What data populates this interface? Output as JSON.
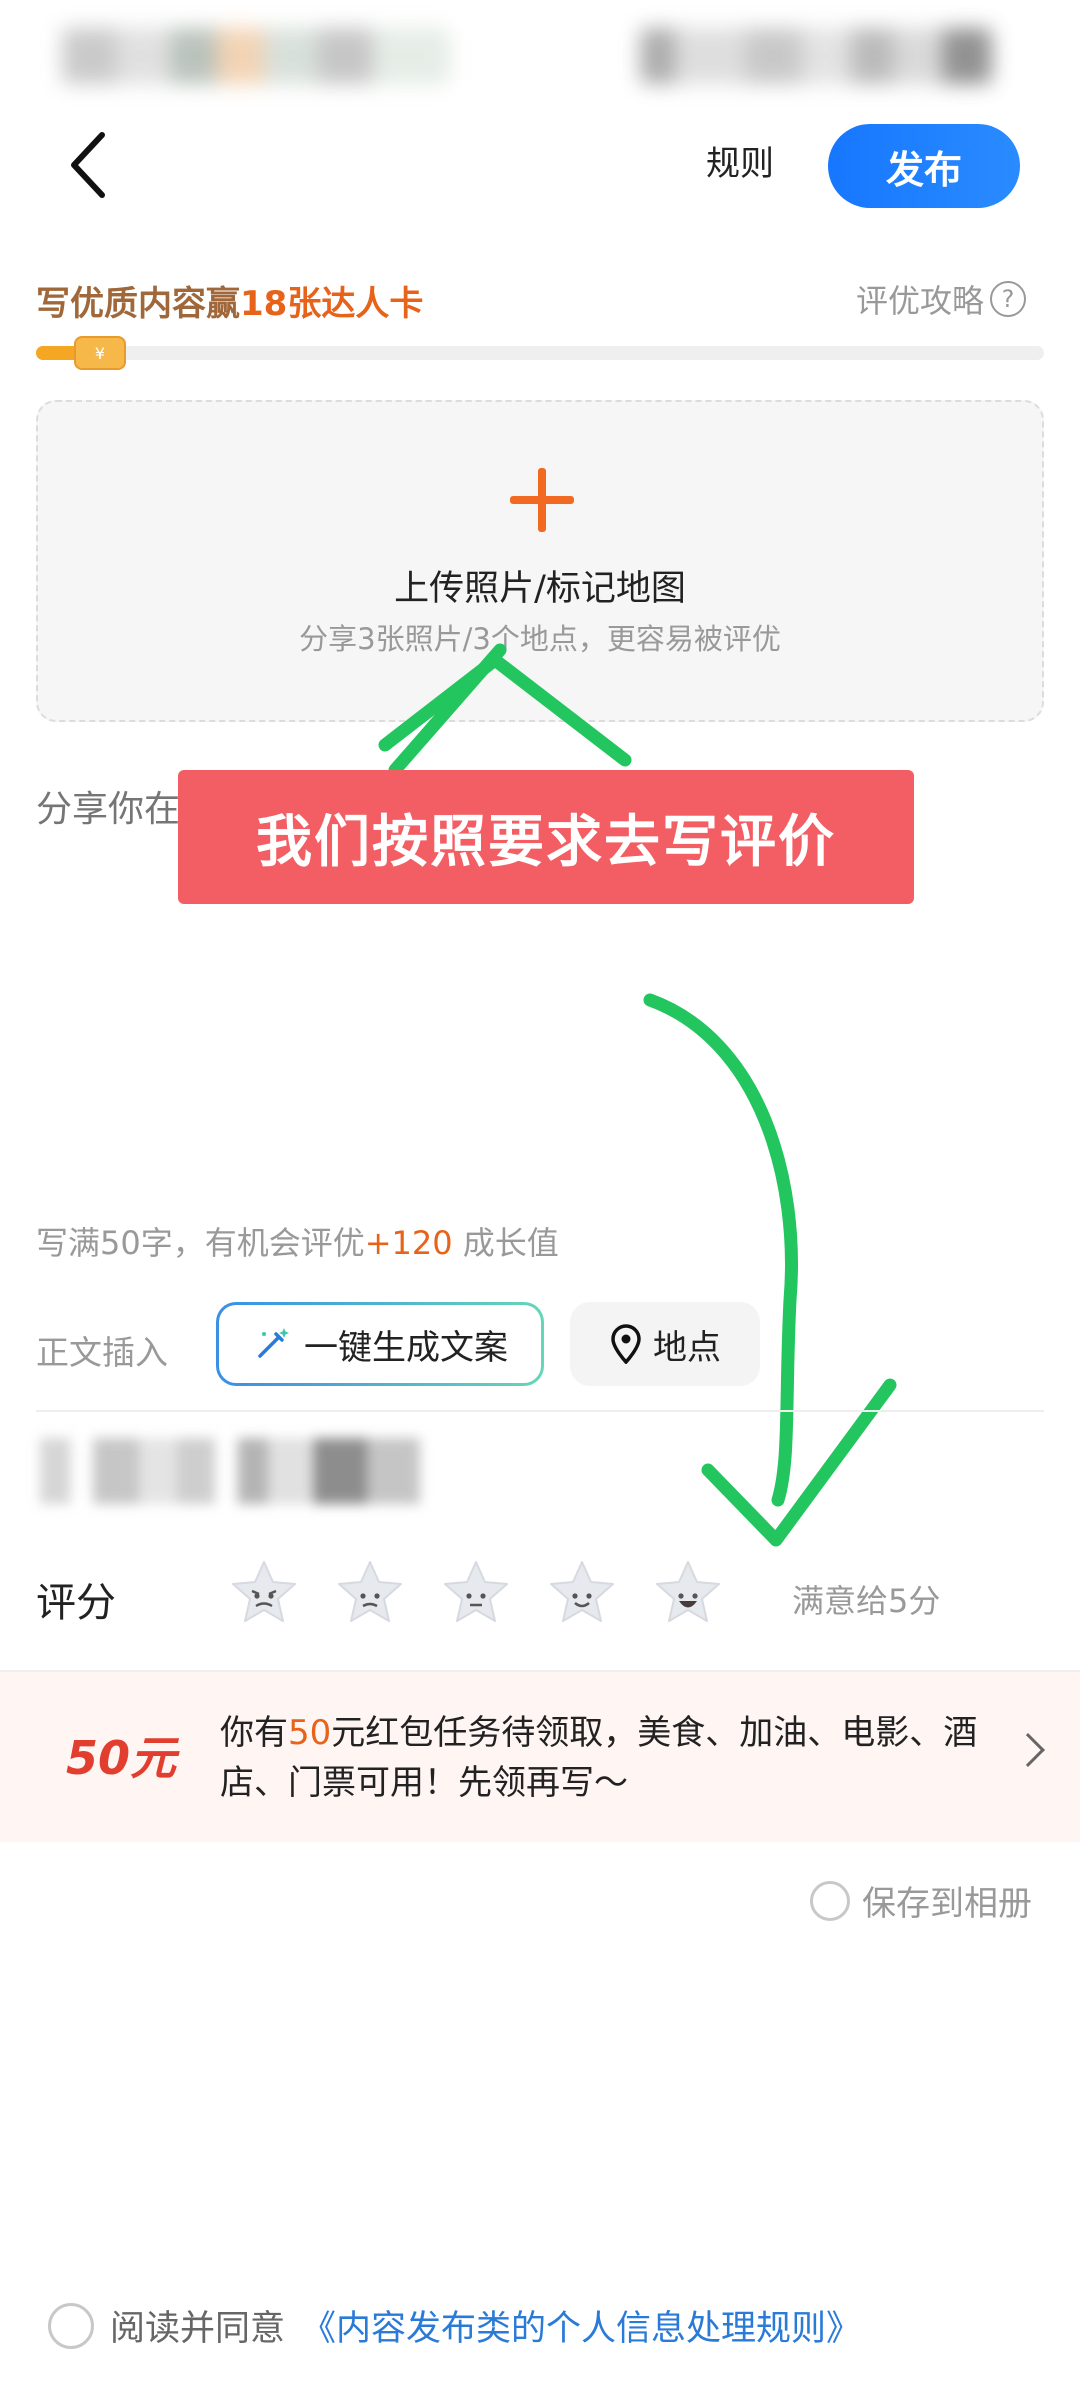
{
  "header": {
    "rules_label": "规则",
    "publish_label": "发布"
  },
  "promo": {
    "title_prefix": "写优质内容赢",
    "title_highlight": "18张达人卡",
    "guide_label": "评优攻略",
    "progress_fraction": 0.08,
    "coin_symbol": "¥"
  },
  "upload": {
    "title": "上传照片/标记地图",
    "subtitle": "分享3张照片/3个地点，更容易被评优"
  },
  "editor": {
    "placeholder": "分享你在",
    "word_hint_prefix": "写满50字，有机会评优",
    "word_hint_highlight": "+120",
    "word_hint_suffix": " 成长值"
  },
  "insert": {
    "label": "正文插入",
    "ai_button": "一键生成文案",
    "location_button": "地点"
  },
  "rating": {
    "label": "评分",
    "hint": "满意给5分",
    "star_faces": [
      "angry",
      "frown",
      "neutral",
      "smile",
      "laugh"
    ]
  },
  "packet": {
    "amount": "50元",
    "text_prefix": "你有",
    "text_highlight": "50",
    "text_suffix": "元红包任务待领取，美食、加油、电影、酒店、门票可用！先领再写～"
  },
  "save_album_label": "保存到相册",
  "agreement": {
    "prefix": "阅读并同意",
    "link": "《内容发布类的个人信息处理规则》"
  },
  "annotation": {
    "banner_text": "我们按照要求去写评价"
  },
  "colors": {
    "primary": "#1677ff",
    "accent_orange": "#e8631a",
    "banner_red": "#f25e63",
    "annotation_green": "#22c55e"
  }
}
